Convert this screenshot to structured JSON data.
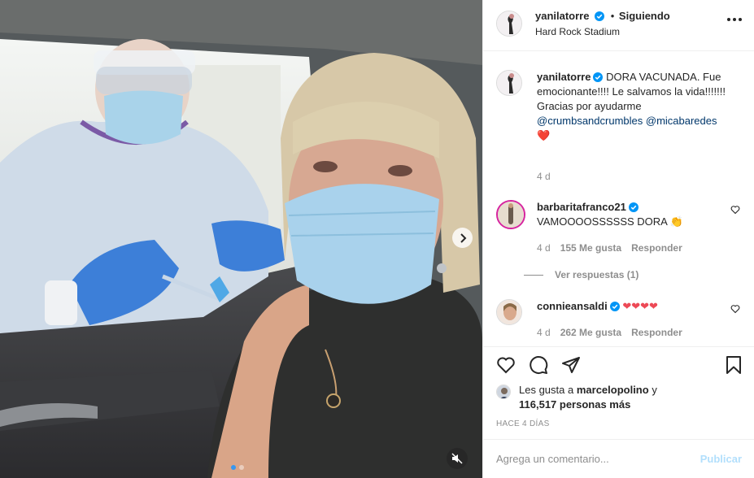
{
  "post": {
    "author": "yanilatorre",
    "separator": "•",
    "follow_status": "Siguiendo",
    "location": "Hard Rock Stadium",
    "more_icon": "ellipsis-icon"
  },
  "caption": {
    "username": "yanilatorre",
    "text_1": "DORA VACUNADA. Fue emocionante!!!! Le salvamos la vida!!!!!!!",
    "text_2": "Gracias por ayudarme",
    "mention_1": "@crumbsandcrumbles",
    "mention_2": "@micabaredes",
    "emoji": "❤️",
    "time": "4 d"
  },
  "comments": [
    {
      "username": "barbaritafranco21",
      "text": "VAMOOOOSSSSSS DORA",
      "emoji": "👏",
      "time": "4 d",
      "likes": "155 Me gusta",
      "reply": "Responder"
    },
    {
      "username": "connieansaldi",
      "text": "",
      "emoji": "❤❤❤❤",
      "time": "4 d",
      "likes": "262 Me gusta",
      "reply": "Responder"
    }
  ],
  "view_replies": "Ver respuestas (1)",
  "likes": {
    "prefix": "Les gusta a",
    "user": "marcelopolino",
    "conj": "y",
    "count": "116,517 personas más"
  },
  "time_ago": "HACE 4 DÍAS",
  "add_comment": {
    "placeholder": "Agrega un comentario...",
    "publish": "Publicar"
  },
  "carousel": {
    "slides": 2,
    "active": 1
  },
  "colors": {
    "verified": "#0095f6",
    "mention": "#00376b",
    "publish_disabled": "#b2dffc",
    "heart": "#ed4956"
  }
}
